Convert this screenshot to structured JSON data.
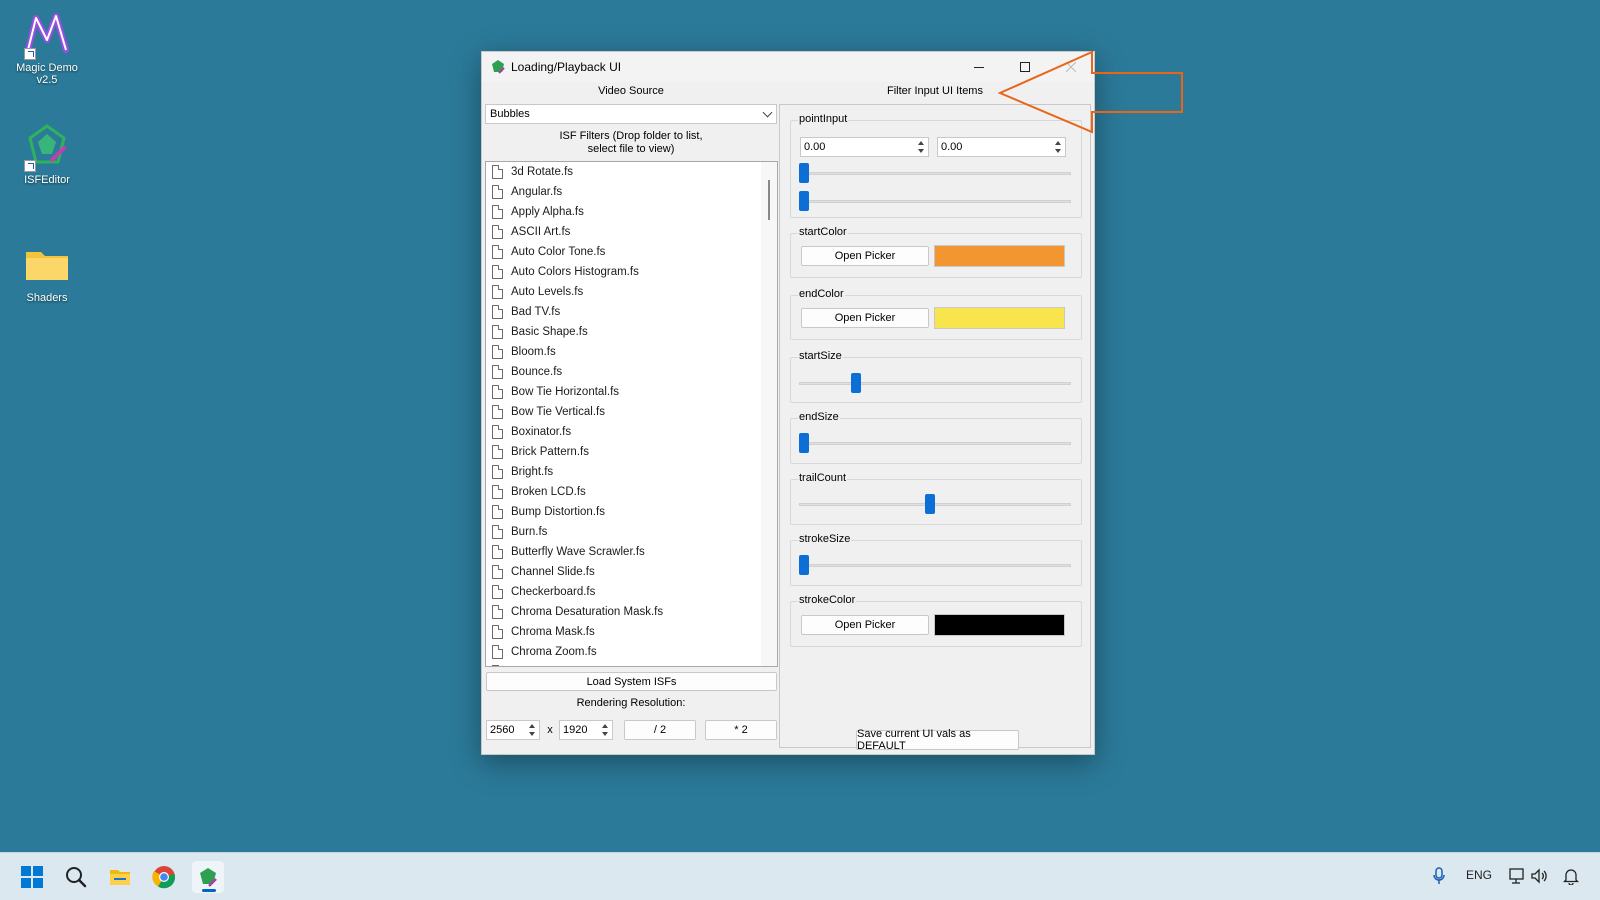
{
  "desktop": {
    "icons": [
      {
        "label": "Magic Demo v2.5",
        "icon": "magic-demo-icon"
      },
      {
        "label": "ISFEditor",
        "icon": "isf-editor-icon"
      },
      {
        "label": "Shaders",
        "icon": "folder-icon"
      }
    ]
  },
  "window": {
    "title": "Loading/Playback UI",
    "video_source_label": "Video Source",
    "video_source_value": "Bubbles",
    "isf_filters_label_line1": "ISF Filters (Drop folder to list,",
    "isf_filters_label_line2": "select file to view)",
    "files": [
      "3d Rotate.fs",
      "Angular.fs",
      "Apply Alpha.fs",
      "ASCII Art.fs",
      "Auto Color Tone.fs",
      "Auto Colors Histogram.fs",
      "Auto Levels.fs",
      "Bad TV.fs",
      "Basic Shape.fs",
      "Bloom.fs",
      "Bounce.fs",
      "Bow Tie Horizontal.fs",
      "Bow Tie Vertical.fs",
      "Boxinator.fs",
      "Brick Pattern.fs",
      "Bright.fs",
      "Broken LCD.fs",
      "Bump Distortion.fs",
      "Burn.fs",
      "Butterfly Wave Scrawler.fs",
      "Channel Slide.fs",
      "Checkerboard.fs",
      "Chroma Desaturation Mask.fs",
      "Chroma Mask.fs",
      "Chroma Zoom.fs",
      "Circle Crop.fs"
    ],
    "load_system_label": "Load System ISFs",
    "rendering_resolution_label": "Rendering Resolution:",
    "res_width": "2560",
    "res_x": "x",
    "res_height": "1920",
    "halve_label": "/ 2",
    "double_label": "* 2",
    "filter_input_label": "Filter Input UI Items",
    "point_input": {
      "title": "pointInput",
      "x": "0.00",
      "y": "0.00",
      "slider_x": 0.0,
      "slider_y": 0.0
    },
    "start_color": {
      "title": "startColor",
      "button": "Open Picker",
      "color": "#f39530"
    },
    "end_color": {
      "title": "endColor",
      "button": "Open Picker",
      "color": "#f8e44c"
    },
    "start_size": {
      "title": "startSize",
      "value": 0.2
    },
    "end_size": {
      "title": "endSize",
      "value": 0.0
    },
    "trail_count": {
      "title": "trailCount",
      "value": 0.48
    },
    "stroke_size": {
      "title": "strokeSize",
      "value": 0.0
    },
    "stroke_color": {
      "title": "strokeColor",
      "button": "Open Picker",
      "color": "#000000"
    },
    "save_default_label": "Save current UI vals as DEFAULT"
  },
  "taskbar": {
    "items": [
      "start-icon",
      "search-icon",
      "file-explorer-icon",
      "chrome-icon",
      "isf-editor-icon"
    ],
    "language": "ENG"
  },
  "accent_colors": {
    "annotation": "#e8651a",
    "slider": "#0b6fd6",
    "desktop": "#2b7a99"
  }
}
